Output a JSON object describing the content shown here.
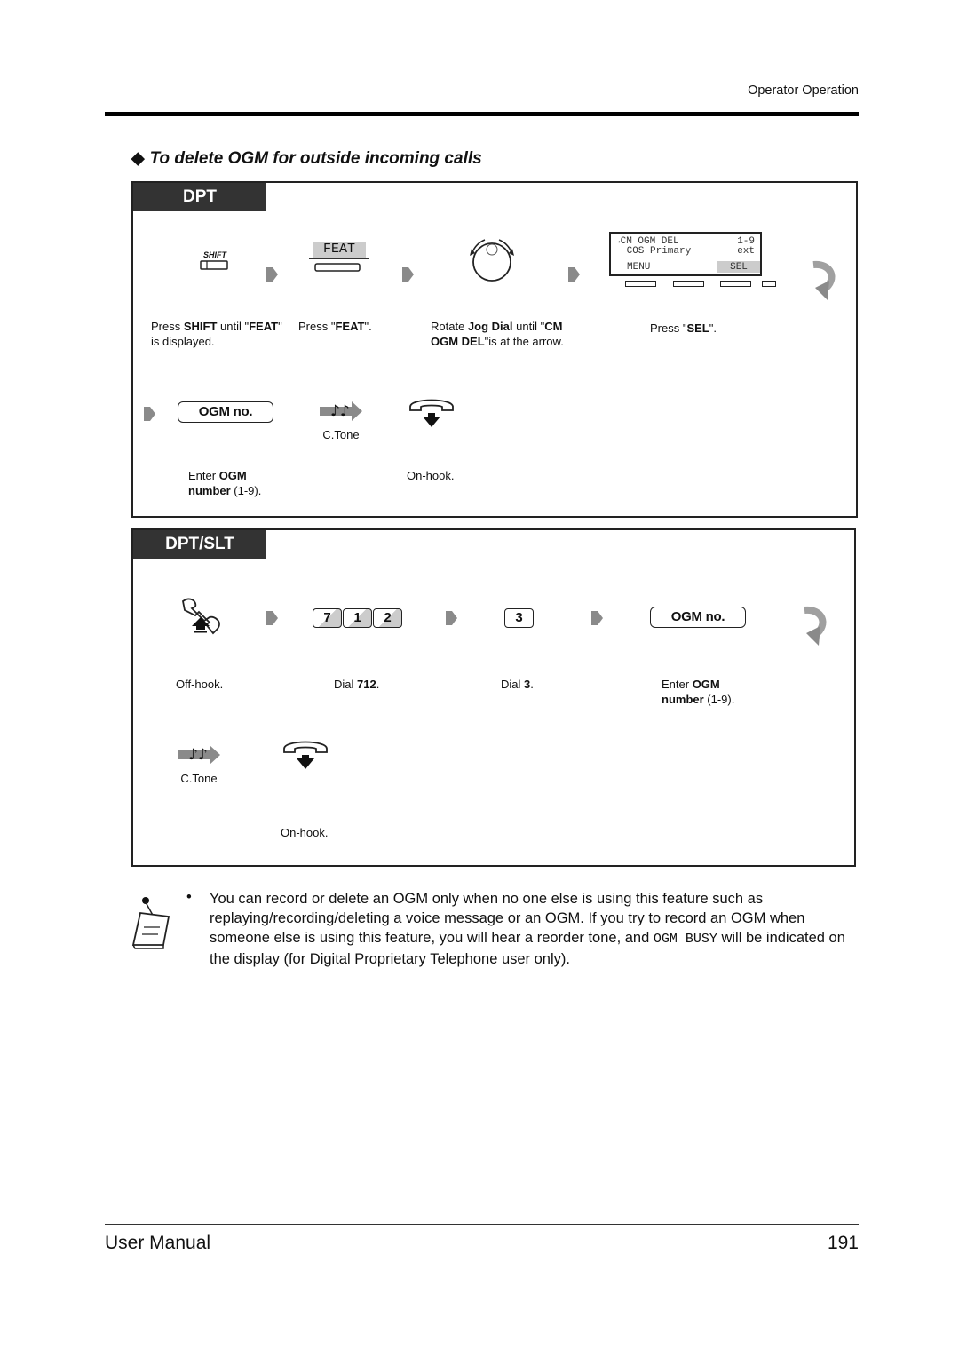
{
  "header": {
    "section": "Operator Operation"
  },
  "title": {
    "bullet_icon": "diamond-icon",
    "text": "To delete OGM for outside incoming calls"
  },
  "dpt_panel": {
    "tab": "DPT",
    "row1": [
      {
        "icon": "shift-key-icon",
        "icon_label": "SHIFT",
        "desc_pre": "Press ",
        "desc_b1": "SHIFT",
        "desc_mid": " until \"",
        "desc_b2": "FEAT",
        "desc_post": "\" is displayed."
      },
      {
        "icon": "feat-key-icon",
        "icon_label": "FEAT",
        "desc_pre": "Press \"",
        "desc_b1": "FEAT",
        "desc_post": "\"."
      },
      {
        "icon": "jog-dial-icon",
        "desc_pre": "Rotate ",
        "desc_b1": "Jog Dial",
        "desc_mid": " until \"",
        "desc_b2": "CM OGM DEL",
        "desc_post": "\"is at the arrow."
      },
      {
        "icon": "lcd-display-icon",
        "desc_pre": "Press \"",
        "desc_b1": "SEL",
        "desc_post": "\"."
      }
    ],
    "lcd": {
      "line1_left": "→CM OGM DEL",
      "line1_right": "1-9",
      "line2_left": " COS Primary",
      "line2_right": "ext",
      "softkey_left": "MENU",
      "softkey_right": "SEL"
    },
    "row2": [
      {
        "icon": "ogm-number-key",
        "label": "OGM no.",
        "desc_pre": "Enter ",
        "desc_b1": "OGM",
        "desc_b2": "number",
        "desc_post": " (1-9)."
      },
      {
        "icon": "confirmation-tone-icon",
        "label": "C.Tone"
      },
      {
        "icon": "on-hook-icon",
        "desc": "On-hook."
      }
    ]
  },
  "dpt_slt_panel": {
    "tab": "DPT/SLT",
    "row1": [
      {
        "icon": "off-hook-icon",
        "desc": "Off-hook."
      },
      {
        "keys": [
          "7",
          "1",
          "2"
        ],
        "desc_pre": "Dial ",
        "desc_b1": "712",
        "desc_post": "."
      },
      {
        "keys": [
          "3"
        ],
        "desc_pre": "Dial ",
        "desc_b1": "3",
        "desc_post": "."
      },
      {
        "icon": "ogm-number-key",
        "label": "OGM no.",
        "desc_pre": "Enter ",
        "desc_b1": "OGM",
        "desc_b2": "number",
        "desc_post": " (1-9)."
      }
    ],
    "row2": [
      {
        "icon": "confirmation-tone-icon",
        "label": "C.Tone"
      },
      {
        "icon": "on-hook-icon",
        "desc": "On-hook."
      }
    ]
  },
  "note": {
    "icon": "notepad-icon",
    "bullet": "•",
    "text_1": "You can record or delete an OGM only when no one else is using this feature such as replaying/recording/deleting a voice message or an OGM. If you try to record an OGM when someone else is using this feature, you will hear a reorder tone, and ",
    "text_mono": "OGM BUSY",
    "text_2": " will be indicated on the display (for Digital Proprietary Telephone user only)."
  },
  "footer": {
    "left": "User Manual",
    "page_number": "191"
  },
  "colors": {
    "tab_bg": "#333333",
    "arrow_gray": "#8a8a8a",
    "key_shade": "#cccccc"
  }
}
